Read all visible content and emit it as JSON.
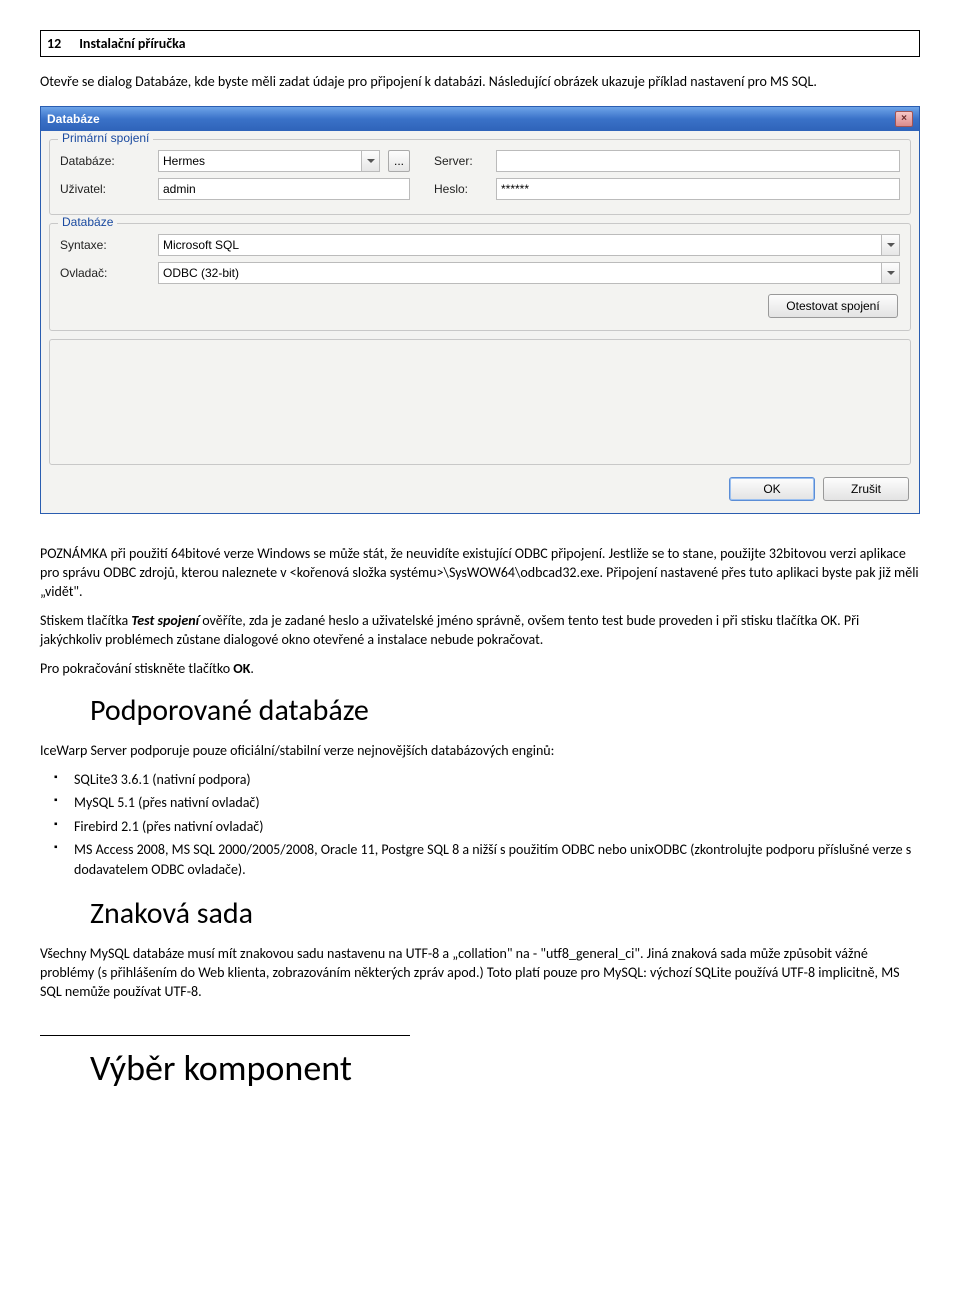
{
  "header": {
    "page_number": "12",
    "doc_title": "Instalační příručka"
  },
  "intro_text": "Otevře se dialog Databáze, kde byste měli zadat údaje pro připojení k databázi. Následující obrázek ukazuje příklad nastavení pro MS SQL.",
  "dialog": {
    "title": "Databáze",
    "close_icon": "×",
    "group_primary": {
      "legend": "Primární spojení",
      "labels": {
        "database": "Databáze:",
        "user": "Uživatel:",
        "server": "Server:",
        "password": "Heslo:"
      },
      "values": {
        "database": "Hermes",
        "user": "admin",
        "server": "",
        "password": "******"
      },
      "browse_btn": "..."
    },
    "group_database": {
      "legend": "Databáze",
      "labels": {
        "syntax": "Syntaxe:",
        "driver": "Ovladač:"
      },
      "values": {
        "syntax": "Microsoft SQL",
        "driver": "ODBC (32-bit)"
      },
      "test_btn": "Otestovat spojení"
    },
    "buttons": {
      "ok": "OK",
      "cancel": "Zrušit"
    }
  },
  "body": {
    "note": "POZNÁMKA při použití 64bitové verze Windows se může stát, že neuvidíte existující ODBC připojení. Jestliže se to stane, použijte 32bitovou verzi aplikace pro správu ODBC zdrojů, kterou naleznete v <kořenová složka systému>\\SysWOW64\\odbcad32.exe. Připojení nastavené přes tuto aplikaci byste pak již měli „vidět\".",
    "p2_prefix": "Stiskem tlačítka ",
    "p2_bold": "Test spojení",
    "p2_suffix": " ověříte, zda je zadané heslo a uživatelské jméno správně, ovšem tento test bude proveden i při stisku tlačítka OK. Při jakýchkoliv problémech zůstane dialogové okno otevřené a instalace nebude pokračovat.",
    "p3_prefix": "Pro pokračování stiskněte tlačítko ",
    "p3_bold": "OK",
    "p3_suffix": "."
  },
  "section_db": {
    "heading": "Podporované databáze",
    "intro": "IceWarp Server podporuje pouze oficiální/stabilní verze nejnovějších databázových enginů:",
    "items": [
      "SQLite3 3.6.1 (nativní podpora)",
      "MySQL 5.1 (přes nativní ovladač)",
      "Firebird 2.1 (přes nativní ovladač)",
      "MS Access 2008, MS SQL 2000/2005/2008, Oracle 11, Postgre SQL 8 a nižší s použitím ODBC nebo unixODBC (zkontrolujte podporu příslušné verze s dodavatelem ODBC ovladače)."
    ]
  },
  "section_charset": {
    "heading": "Znaková sada",
    "text": "Všechny MySQL databáze musí mít znakovou sadu nastavenu na UTF-8 a „collation\" na - \"utf8_general_ci\". Jiná znaková sada může způsobit vážné problémy (s přihlášením do Web klienta, zobrazováním některých zpráv apod.) Toto platí pouze pro MySQL: výchozí SQLite používá UTF-8 implicitně, MS SQL nemůže používat UTF-8."
  },
  "footer_heading": "Výběr komponent"
}
